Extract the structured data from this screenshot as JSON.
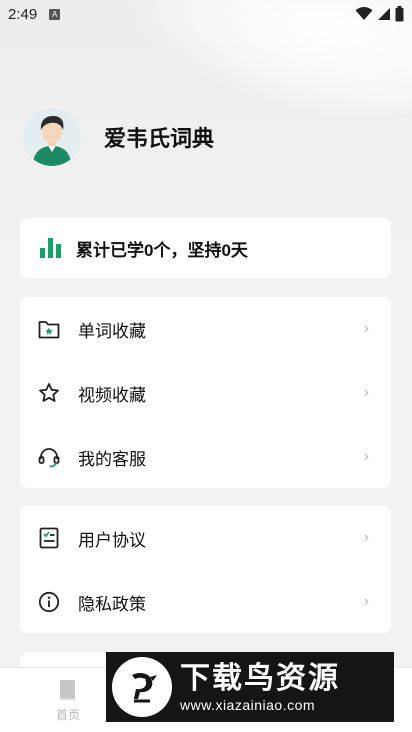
{
  "status_bar": {
    "time": "2:49",
    "notification_icon": "A"
  },
  "profile": {
    "name": "爱韦氏词典"
  },
  "stats": {
    "text": "累计已学0个，坚持0天",
    "icon_color": "#1f9c6a"
  },
  "menu_group_1": [
    {
      "label": "单词收藏",
      "icon": "folder-star-icon"
    },
    {
      "label": "视频收藏",
      "icon": "star-icon"
    },
    {
      "label": "我的客服",
      "icon": "headset-icon"
    }
  ],
  "menu_group_2": [
    {
      "label": "用户协议",
      "icon": "agreement-icon"
    },
    {
      "label": "隐私政策",
      "icon": "info-icon"
    }
  ],
  "chevron": "›",
  "bottom_nav": {
    "home_label": "首页"
  },
  "watermark": {
    "title": "下载鸟资源",
    "url": "www.xiazainiao.com"
  },
  "colors": {
    "accent": "#1f9c6a",
    "background": "#f2f2f2",
    "card": "#ffffff"
  }
}
